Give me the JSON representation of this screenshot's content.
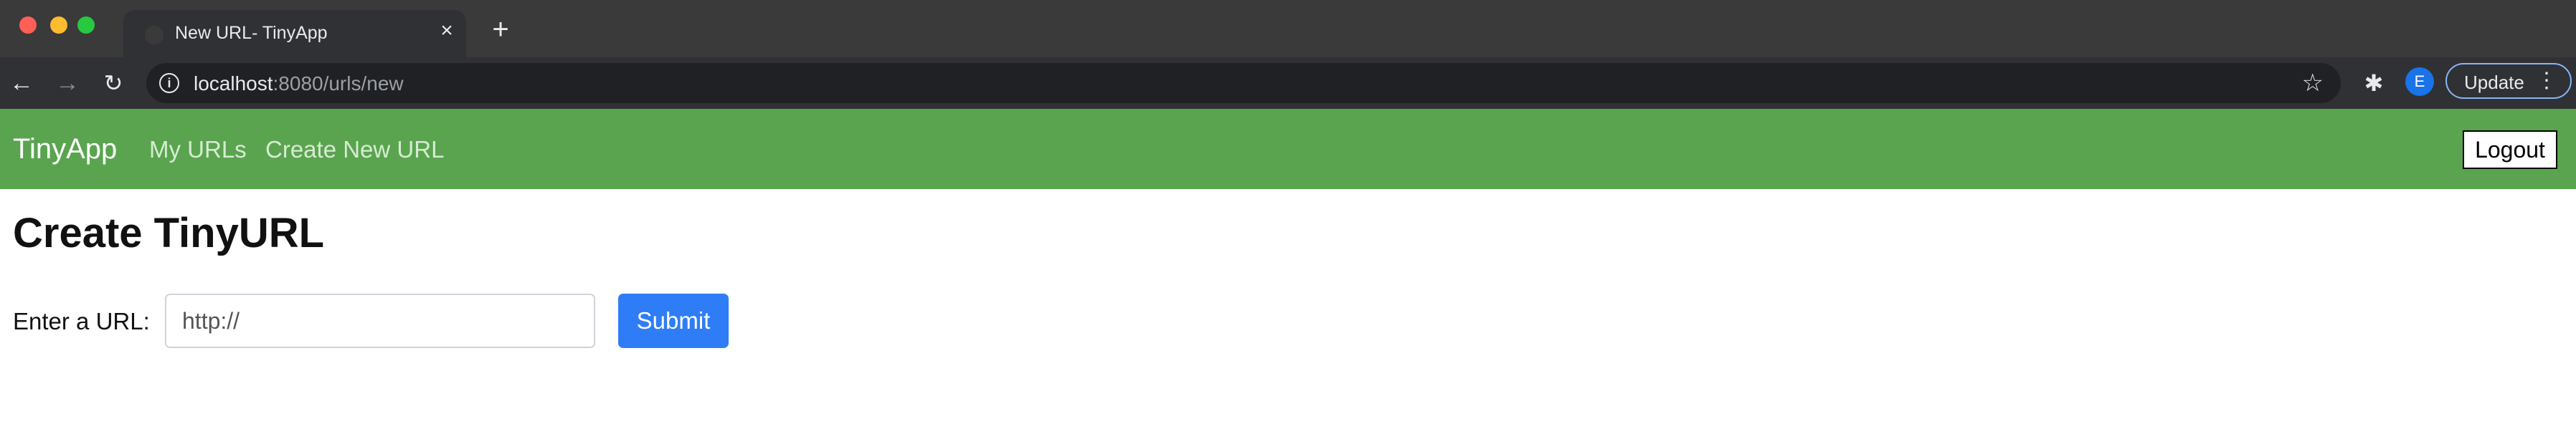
{
  "browser": {
    "tab_title": "New URL- TinyApp",
    "tab_close_symbol": "×",
    "new_tab_symbol": "+",
    "back_symbol": "←",
    "forward_symbol": "→",
    "reload_symbol": "↻",
    "info_symbol": "i",
    "bookmark_symbol": "☆",
    "extensions_symbol": "✱",
    "profile_initial": "E",
    "update_label": "Update",
    "menu_symbol": "⋮",
    "url_host": "localhost",
    "url_path": ":8080/urls/new"
  },
  "app": {
    "brand": "TinyApp",
    "nav": {
      "my_urls": "My URLs",
      "create_new_url": "Create New URL"
    },
    "logout_label": "Logout"
  },
  "page": {
    "title": "Create TinyURL",
    "url_label": "Enter a URL:",
    "url_placeholder": "http://",
    "url_value": "",
    "submit_label": "Submit"
  },
  "colors": {
    "navbar": "#5aa44f",
    "submit": "#2f7df6",
    "browser_toolbar": "#303134"
  }
}
